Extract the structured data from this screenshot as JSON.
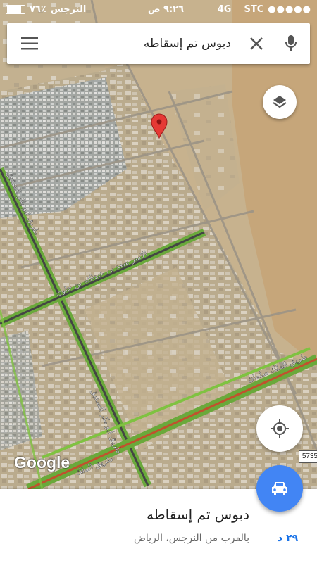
{
  "status_bar": {
    "carrier": "STC",
    "network": "4G",
    "time": "٩:٢٦ ص",
    "location_name": "النرجس",
    "battery_percent": "٧٦٪"
  },
  "search": {
    "query": "دبوس تم إسقاطه"
  },
  "map": {
    "roads": {
      "prince_saad": "الامير سعد بن عبدالله بن جلوي",
      "abu_bakr_v": "طريق ابو بكر الصديق",
      "abu_bakr_left": "طريق ابو بكر الصديق",
      "king_salman": "طريق الملك سلمان",
      "king_bottom": "طريق الملك"
    },
    "route_shield": "5735",
    "attribution": "Google",
    "pin_color": "#e53935"
  },
  "place_sheet": {
    "title": "دبوس تم إسقاطه",
    "subtitle": "بالقرب من النرجس، الرياض",
    "eta": "٢٩ د"
  },
  "colors": {
    "accent": "#4285f4",
    "road_traffic": "#7fc241",
    "ground": "#c9b591"
  },
  "icons": {
    "menu": "menu-icon",
    "clear": "close-icon",
    "mic": "microphone-icon",
    "layers": "layers-icon",
    "locate": "my-location-icon",
    "directions": "car-icon"
  }
}
